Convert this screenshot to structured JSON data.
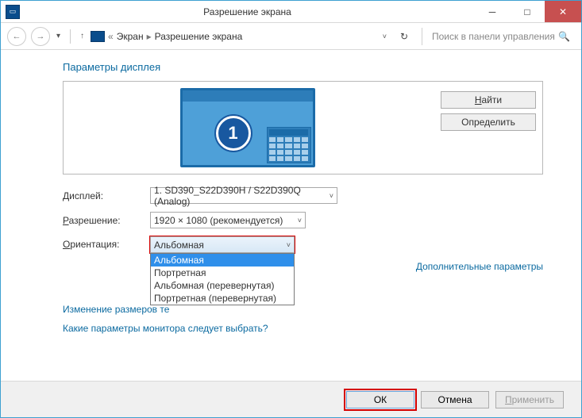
{
  "window": {
    "title": "Разрешение экрана"
  },
  "breadcrumb": {
    "item1": "Экран",
    "item2": "Разрешение экрана"
  },
  "search": {
    "placeholder": "Поиск в панели управления"
  },
  "heading": "Параметры дисплея",
  "monitor_number": "1",
  "buttons": {
    "find": "Найти",
    "detect": "Определить",
    "ok": "ОК",
    "cancel": "Отмена",
    "apply": "Применить"
  },
  "labels": {
    "display": "Дисплей:",
    "resolution": "Разрешение:",
    "orientation": "Ориентация:"
  },
  "values": {
    "display": "1. SD390_S22D390H / S22D390Q (Analog)",
    "resolution": "1920 × 1080 (рекомендуется)",
    "orientation": "Альбомная"
  },
  "orientation_options": {
    "o1": "Альбомная",
    "o2": "Портретная",
    "o3": "Альбомная (перевернутая)",
    "o4": "Портретная (перевернутая)"
  },
  "links": {
    "advanced": "Дополнительные параметры",
    "resize": "Изменение размеров те",
    "which_monitor": "Какие параметры монитора следует выбрать?"
  }
}
